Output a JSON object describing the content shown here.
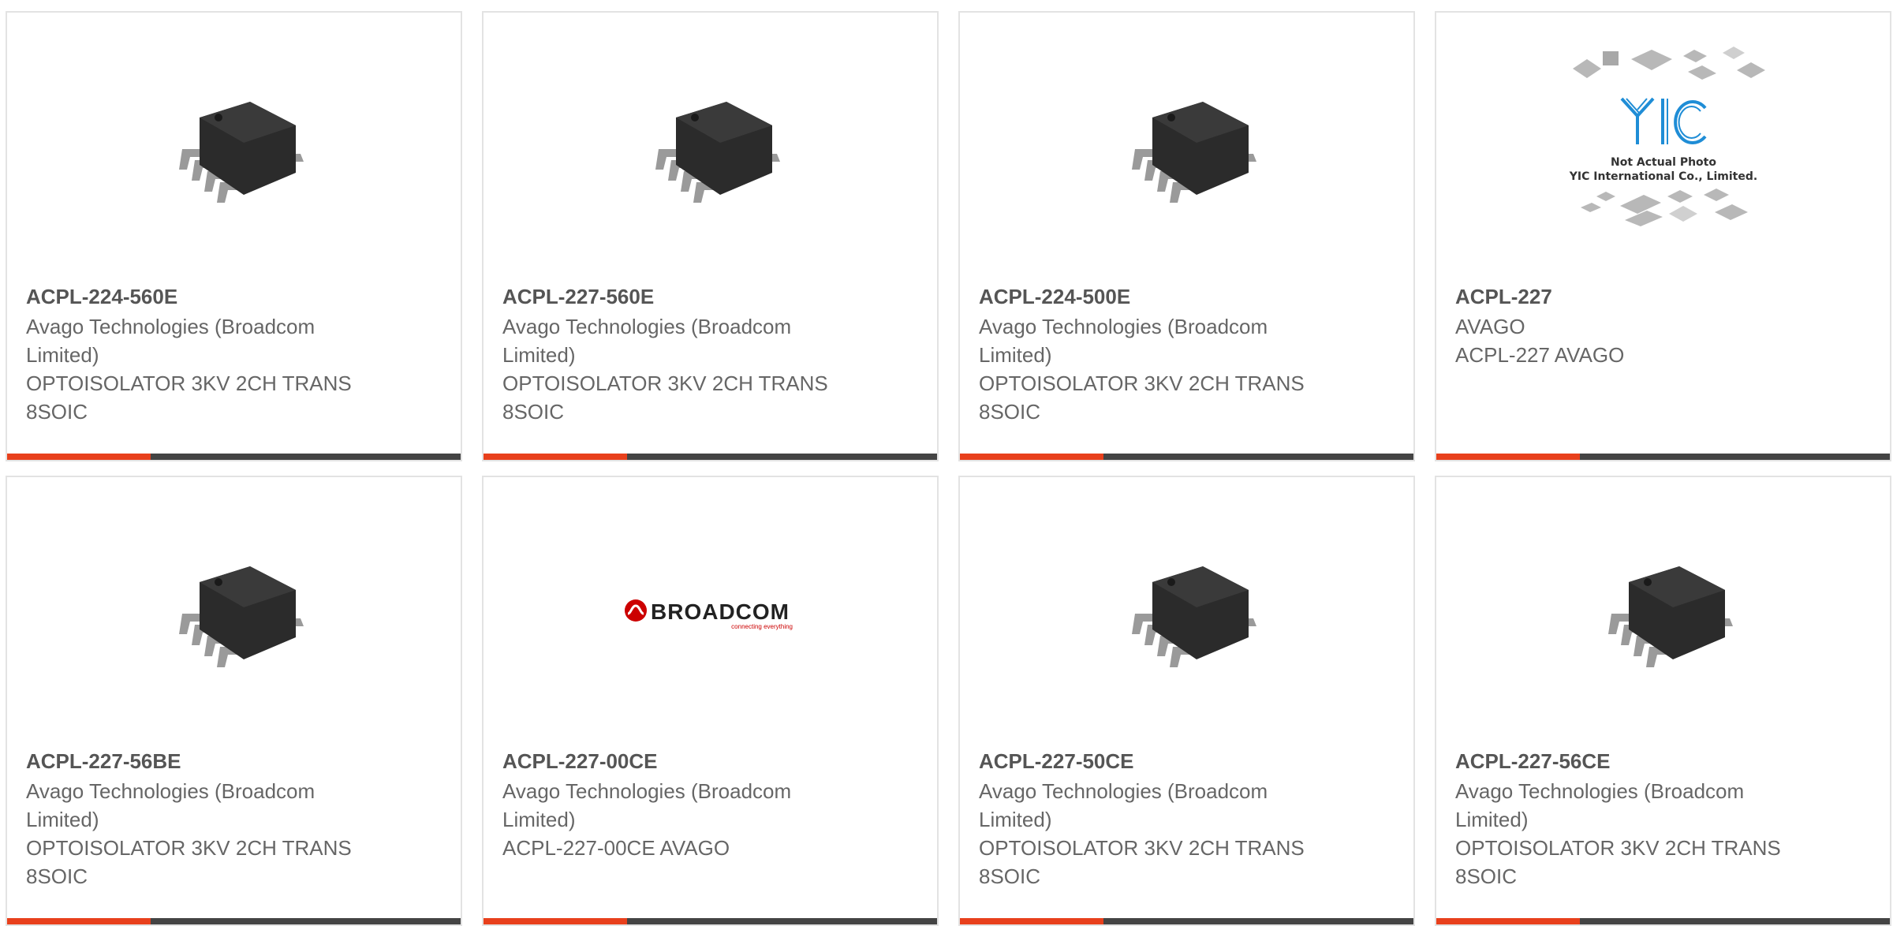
{
  "products": [
    {
      "part": "ACPL-224-560E",
      "manufacturer": "Avago Technologies (Broadcom Limited)",
      "description": "OPTOISOLATOR 3KV 2CH TRANS 8SOIC",
      "image": "chip-image"
    },
    {
      "part": "ACPL-227-560E",
      "manufacturer": "Avago Technologies (Broadcom Limited)",
      "description": "OPTOISOLATOR 3KV 2CH TRANS 8SOIC",
      "image": "chip-image"
    },
    {
      "part": "ACPL-224-500E",
      "manufacturer": "Avago Technologies (Broadcom Limited)",
      "description": "OPTOISOLATOR 3KV 2CH TRANS 8SOIC",
      "image": "chip-image"
    },
    {
      "part": "ACPL-227",
      "manufacturer": "AVAGO",
      "description": "ACPL-227 AVAGO",
      "image": "not-actual-photo-image",
      "image_text": [
        "Not Actual Photo",
        "YIC International Co., Limited."
      ]
    },
    {
      "part": "ACPL-227-56BE",
      "manufacturer": "Avago Technologies (Broadcom Limited)",
      "description": "OPTOISOLATOR 3KV 2CH TRANS 8SOIC",
      "image": "chip-image"
    },
    {
      "part": "ACPL-227-00CE",
      "manufacturer": "Avago Technologies (Broadcom Limited)",
      "description": "ACPL-227-00CE AVAGO",
      "image": "broadcom-logo",
      "image_text": [
        "BROADCOM",
        "connecting everything"
      ]
    },
    {
      "part": "ACPL-227-50CE",
      "manufacturer": "Avago Technologies (Broadcom Limited)",
      "description": "OPTOISOLATOR 3KV 2CH TRANS 8SOIC",
      "image": "chip-image"
    },
    {
      "part": "ACPL-227-56CE",
      "manufacturer": "Avago Technologies (Broadcom Limited)",
      "description": "OPTOISOLATOR 3KV 2CH TRANS 8SOIC",
      "image": "chip-image"
    }
  ],
  "colors": {
    "accent_bar": "#e8401c",
    "dark_bar": "#444444",
    "card_border": "#e3e3e3",
    "text": "#666666"
  }
}
